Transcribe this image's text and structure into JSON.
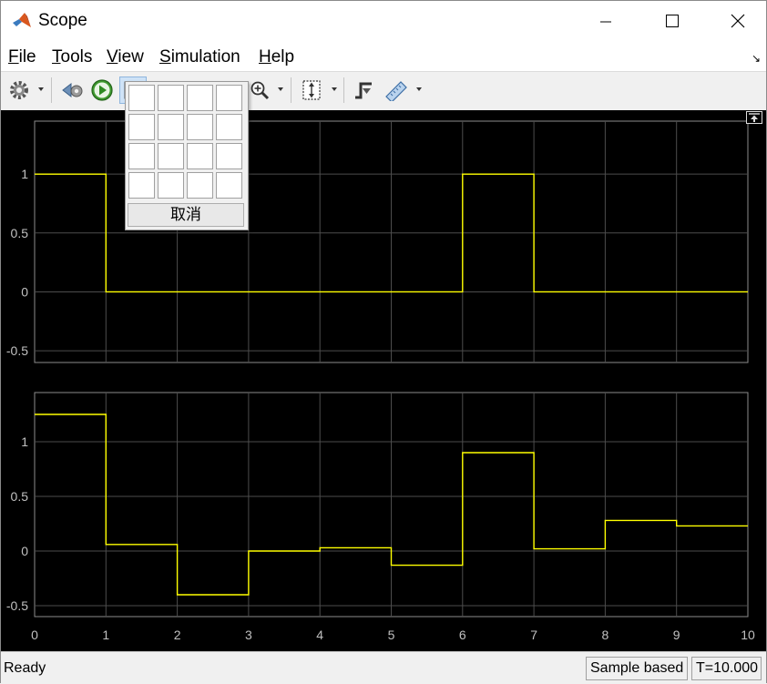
{
  "window": {
    "title": "Scope"
  },
  "menu": [
    "File",
    "Tools",
    "View",
    "Simulation",
    "Help"
  ],
  "layout_popup": {
    "rows": 4,
    "cols": 4,
    "cancel_label": "取消"
  },
  "status": {
    "text": "Ready",
    "mode": "Sample based",
    "time": "T=10.000"
  },
  "colors": {
    "plot_bg": "#000000",
    "axes_bg": "#000000",
    "grid": "#4d4d4d",
    "trace": "#ffff00",
    "tick_text": "#c0c0c0"
  },
  "icons": [
    "settings-gear-icon",
    "step-back-icon",
    "run-icon",
    "layout-icon",
    "highlight-icon",
    "zoom-icon",
    "autoscale-icon",
    "triggers-icon",
    "measurements-icon"
  ],
  "chart_data": [
    {
      "type": "line",
      "step": true,
      "x": [
        0,
        1,
        2,
        3,
        4,
        5,
        6,
        7,
        8,
        9,
        10
      ],
      "y": [
        1,
        0,
        0,
        0,
        0,
        0,
        1,
        0,
        0,
        0,
        0
      ],
      "xlim": [
        0,
        10
      ],
      "ylim": [
        -0.6,
        1.45
      ],
      "yticks": [
        -0.5,
        0,
        0.5,
        1
      ],
      "ytick_labels": [
        "-0.5",
        "0",
        "0.5",
        "1"
      ],
      "grid": true
    },
    {
      "type": "line",
      "step": true,
      "x": [
        0,
        1,
        2,
        3,
        4,
        5,
        6,
        7,
        8,
        9,
        10
      ],
      "y": [
        1.25,
        0.06,
        -0.4,
        0.0,
        0.03,
        -0.13,
        0.9,
        0.02,
        0.28,
        0.23,
        0.23
      ],
      "xlim": [
        0,
        10
      ],
      "ylim": [
        -0.6,
        1.45
      ],
      "yticks": [
        -0.5,
        0,
        0.5,
        1
      ],
      "ytick_labels": [
        "-0.5",
        "0",
        "0.5",
        "1"
      ],
      "xtick_labels": [
        "0",
        "1",
        "2",
        "3",
        "4",
        "5",
        "6",
        "7",
        "8",
        "9",
        "10"
      ],
      "grid": true
    }
  ]
}
